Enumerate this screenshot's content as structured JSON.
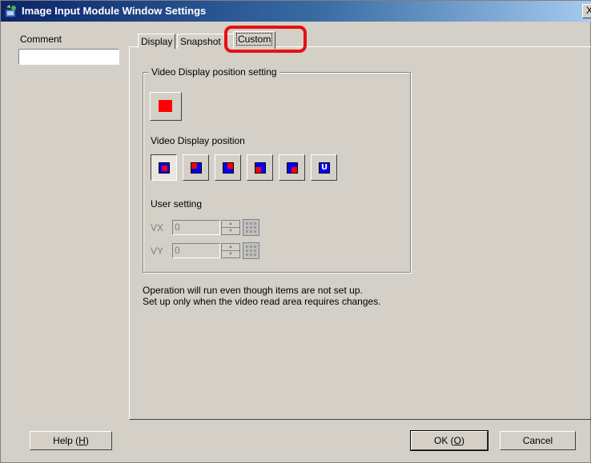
{
  "window": {
    "title": "Image Input Module Window Settings",
    "close_glyph": "X"
  },
  "comment": {
    "label": "Comment",
    "value": ""
  },
  "tabs": [
    {
      "label": "Display",
      "active": false
    },
    {
      "label": "Snapshot",
      "active": false
    },
    {
      "label": "Custom",
      "active": true
    }
  ],
  "group": {
    "title": "Video Display position setting",
    "position_label": "Video Display position",
    "position_buttons": [
      {
        "icon": "position-center-icon",
        "pressed": true
      },
      {
        "icon": "position-top-left-icon",
        "pressed": false
      },
      {
        "icon": "position-top-right-icon",
        "pressed": false
      },
      {
        "icon": "position-bottom-left-icon",
        "pressed": false
      },
      {
        "icon": "position-bottom-right-icon",
        "pressed": false
      },
      {
        "icon": "position-user-icon",
        "glyph": "U",
        "pressed": false
      }
    ],
    "user_setting_label": "User setting",
    "vx": {
      "label": "VX",
      "value": "0"
    },
    "vy": {
      "label": "VY",
      "value": "0"
    }
  },
  "note": {
    "line1": "Operation will run even though items are not set up.",
    "line2": "Set up only when the video read area requires changes."
  },
  "buttons": {
    "help": {
      "text": "Help (",
      "key": "H",
      "close": ")"
    },
    "ok": {
      "text": "OK (",
      "key": "O",
      "close": ")"
    },
    "cancel": "Cancel"
  },
  "colors": {
    "highlight": "#e81010",
    "title_bar": "#0a246a",
    "dialog_face": "#d4d0c8",
    "marker_red": "#ff0000",
    "marker_blue": "#0000ff"
  }
}
